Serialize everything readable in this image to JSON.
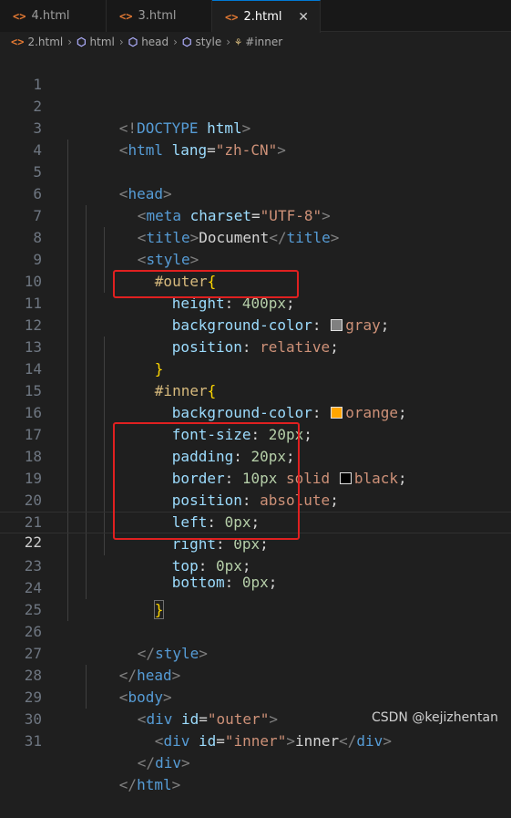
{
  "tabs": [
    {
      "label": "4.html",
      "icon": "html-file-icon"
    },
    {
      "label": "3.html",
      "icon": "html-file-icon"
    },
    {
      "label": "2.html",
      "icon": "html-file-icon",
      "active": true,
      "close": "✕"
    }
  ],
  "breadcrumb": [
    "2.html",
    "html",
    "head",
    "style",
    "#inner"
  ],
  "lines": [
    {
      "n": "1"
    },
    {
      "n": "2"
    },
    {
      "n": "3"
    },
    {
      "n": "4"
    },
    {
      "n": "5"
    },
    {
      "n": "6"
    },
    {
      "n": "7"
    },
    {
      "n": "8"
    },
    {
      "n": "9"
    },
    {
      "n": "10"
    },
    {
      "n": "11"
    },
    {
      "n": "12"
    },
    {
      "n": "13"
    },
    {
      "n": "14"
    },
    {
      "n": "15"
    },
    {
      "n": "16"
    },
    {
      "n": "17"
    },
    {
      "n": "18"
    },
    {
      "n": "19"
    },
    {
      "n": "20"
    },
    {
      "n": "21"
    },
    {
      "n": "22"
    },
    {
      "n": "23"
    },
    {
      "n": "24"
    },
    {
      "n": "25"
    },
    {
      "n": "26"
    },
    {
      "n": "27"
    },
    {
      "n": "28"
    },
    {
      "n": "29"
    },
    {
      "n": "30"
    },
    {
      "n": "31"
    }
  ],
  "current_line": 22,
  "code": {
    "l1": {
      "a": "<!",
      "b": "DOCTYPE",
      "c": " html",
      "d": ">"
    },
    "l2": {
      "a": "<",
      "b": "html",
      "c": " lang",
      "d": "=",
      "e": "\"zh-CN\"",
      "f": ">"
    },
    "l4": {
      "a": "<",
      "b": "head",
      "c": ">"
    },
    "l5": {
      "a": "<",
      "b": "meta",
      "c": " charset",
      "d": "=",
      "e": "\"UTF-8\"",
      "f": ">"
    },
    "l6": {
      "a": "<",
      "b": "title",
      "c": ">",
      "d": "Document",
      "e": "</",
      "f": "title",
      "g": ">"
    },
    "l7": {
      "a": "<",
      "b": "style",
      "c": ">"
    },
    "l8": {
      "sel": "#outer",
      "brace": "{"
    },
    "l9": {
      "prop": "height",
      "colon": ": ",
      "val": "400px",
      "semi": ";"
    },
    "l10": {
      "prop": "background-color",
      "colon": ": ",
      "val": "gray",
      "semi": ";",
      "swatch": "#808080"
    },
    "l11": {
      "prop": "position",
      "colon": ": ",
      "val": "relative",
      "semi": ";"
    },
    "l12": {
      "brace": "}"
    },
    "l13": {
      "sel": "#inner",
      "brace": "{"
    },
    "l14": {
      "prop": "background-color",
      "colon": ": ",
      "val": "orange",
      "semi": ";",
      "swatch": "#ffa500"
    },
    "l15": {
      "prop": "font-size",
      "colon": ": ",
      "val": "20px",
      "semi": ";"
    },
    "l16": {
      "prop": "padding",
      "colon": ": ",
      "val": "20px",
      "semi": ";"
    },
    "l17": {
      "prop": "border",
      "colon": ": ",
      "v1": "10px",
      "v2": " solid ",
      "v3": "black",
      "semi": ";",
      "swatch": "#000000"
    },
    "l18": {
      "prop": "position",
      "colon": ": ",
      "val": "absolute",
      "semi": ";"
    },
    "l19": {
      "prop": "left",
      "colon": ": ",
      "val": "0px",
      "semi": ";"
    },
    "l20": {
      "prop": "right",
      "colon": ": ",
      "val": "0px",
      "semi": ";"
    },
    "l21": {
      "prop": "top",
      "colon": ": ",
      "val": "0px",
      "semi": ";"
    },
    "l22": {
      "prop": "bottom",
      "colon": ": ",
      "val": "0px",
      "semi": ";"
    },
    "l23": {
      "brace": "}"
    },
    "l25": {
      "a": "</",
      "b": "style",
      "c": ">"
    },
    "l26": {
      "a": "</",
      "b": "head",
      "c": ">"
    },
    "l27": {
      "a": "<",
      "b": "body",
      "c": ">"
    },
    "l28": {
      "a": "<",
      "b": "div",
      "c": " id",
      "d": "=",
      "e": "\"outer\"",
      "f": ">"
    },
    "l29": {
      "a": "<",
      "b": "div",
      "c": " id",
      "d": "=",
      "e": "\"inner\"",
      "f": ">",
      "g": "inner",
      "h": "</",
      "i": "div",
      "j": ">"
    },
    "l30": {
      "a": "</",
      "b": "div",
      "c": ">"
    },
    "l31": {
      "a": "</",
      "b": "html",
      "c": ">"
    }
  },
  "watermark": "CSDN @kejizhentan",
  "colors": {
    "annotation_box": "#e02020",
    "active_tab_accent": "#0078d4"
  }
}
